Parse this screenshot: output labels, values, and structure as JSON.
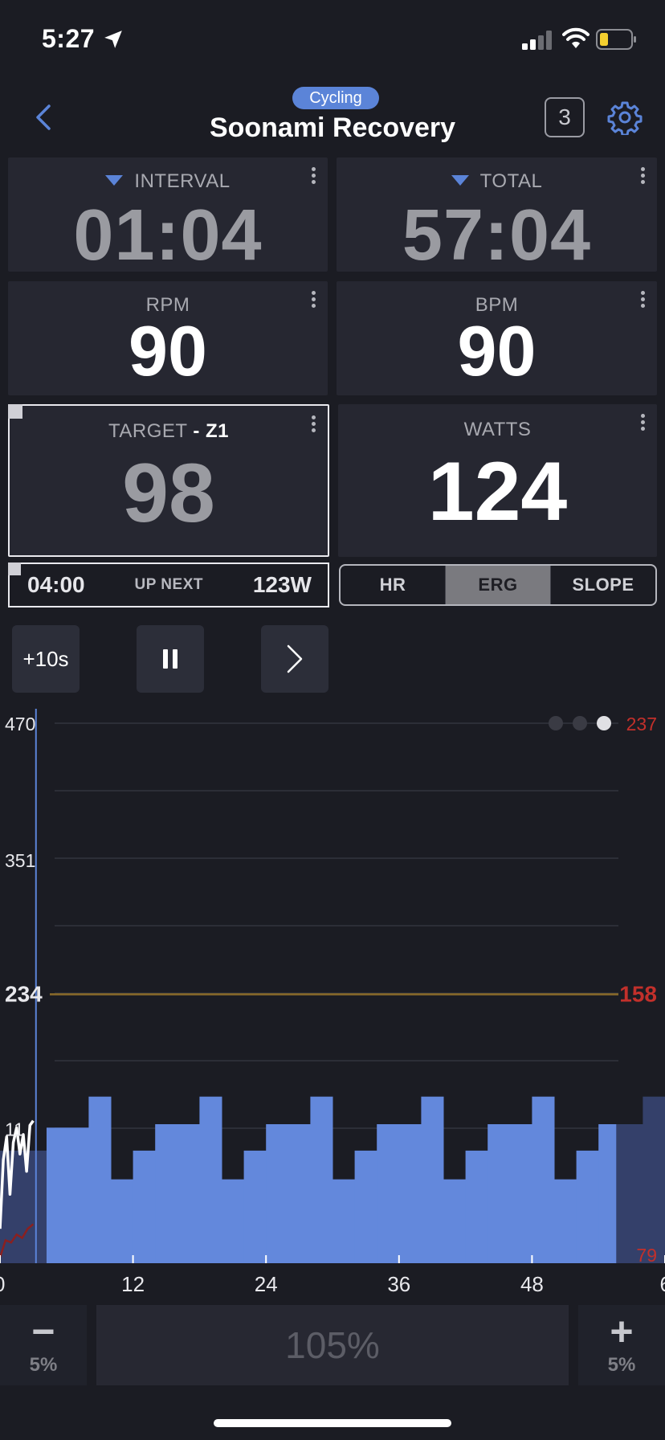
{
  "status_bar": {
    "time": "5:27"
  },
  "header": {
    "category": "Cycling",
    "title": "Soonami Recovery",
    "count": "3"
  },
  "tiles": {
    "interval": {
      "label": "INTERVAL",
      "value": "01:04"
    },
    "total": {
      "label": "TOTAL",
      "value": "57:04"
    },
    "rpm": {
      "label": "RPM",
      "value": "90"
    },
    "bpm": {
      "label": "BPM",
      "value": "90"
    },
    "target": {
      "label": "TARGET",
      "zone": "- Z1",
      "value": "98"
    },
    "watts": {
      "label": "WATTS",
      "value": "124"
    }
  },
  "up_next": {
    "time": "04:00",
    "label": "UP NEXT",
    "watts": "123W"
  },
  "modes": [
    {
      "label": "HR",
      "active": false
    },
    {
      "label": "ERG",
      "active": true
    },
    {
      "label": "SLOPE",
      "active": false
    }
  ],
  "controls": {
    "plus10": "+10s"
  },
  "chart_data": {
    "type": "area",
    "y_ticks_left": [
      "470",
      "351",
      "234",
      "11"
    ],
    "y_ticks_right": [
      "237",
      "158",
      "79"
    ],
    "x_ticks": [
      "0",
      "12",
      "24",
      "36",
      "48",
      "6"
    ],
    "xlim": [
      0,
      60
    ],
    "ylim": [
      0,
      470
    ],
    "ftp_line": 234,
    "current_time": 3.1,
    "segments": [
      {
        "start": 0,
        "end": 4.2,
        "watts": 98
      },
      {
        "start": 4.2,
        "end": 8,
        "watts": 118
      },
      {
        "start": 8,
        "end": 10,
        "watts": 145
      },
      {
        "start": 10,
        "end": 12,
        "watts": 73
      },
      {
        "start": 12,
        "end": 14,
        "watts": 98
      },
      {
        "start": 14,
        "end": 18,
        "watts": 121
      },
      {
        "start": 18,
        "end": 20,
        "watts": 145
      },
      {
        "start": 20,
        "end": 22,
        "watts": 73
      },
      {
        "start": 22,
        "end": 24,
        "watts": 98
      },
      {
        "start": 24,
        "end": 28,
        "watts": 121
      },
      {
        "start": 28,
        "end": 30,
        "watts": 145
      },
      {
        "start": 30,
        "end": 32,
        "watts": 73
      },
      {
        "start": 32,
        "end": 34,
        "watts": 98
      },
      {
        "start": 34,
        "end": 38,
        "watts": 121
      },
      {
        "start": 38,
        "end": 40,
        "watts": 145
      },
      {
        "start": 40,
        "end": 42,
        "watts": 73
      },
      {
        "start": 42,
        "end": 44,
        "watts": 98
      },
      {
        "start": 44,
        "end": 48,
        "watts": 121
      },
      {
        "start": 48,
        "end": 50,
        "watts": 145
      },
      {
        "start": 50,
        "end": 52,
        "watts": 73
      },
      {
        "start": 52,
        "end": 54,
        "watts": 98
      },
      {
        "start": 54,
        "end": 55.6,
        "watts": 121
      },
      {
        "start": 55.6,
        "end": 58,
        "watts": 121
      },
      {
        "start": 58,
        "end": 60,
        "watts": 145
      }
    ],
    "power_trace": [
      [
        0,
        30
      ],
      [
        0.3,
        90
      ],
      [
        0.6,
        110
      ],
      [
        0.9,
        60
      ],
      [
        1.2,
        105
      ],
      [
        1.5,
        118
      ],
      [
        1.8,
        95
      ],
      [
        2.1,
        112
      ],
      [
        2.4,
        80
      ],
      [
        2.7,
        120
      ],
      [
        3.0,
        124
      ]
    ],
    "hr_trace": [
      [
        0,
        5
      ],
      [
        0.5,
        20
      ],
      [
        1.0,
        18
      ],
      [
        1.5,
        25
      ],
      [
        2.0,
        22
      ],
      [
        2.5,
        30
      ],
      [
        3.0,
        34
      ]
    ],
    "colors": {
      "target": "#6388dc",
      "future": "#34406a",
      "ftp": "#8a6a2a",
      "power": "#ffffff",
      "hr": "#8a2020",
      "cursor": "#5b84d8",
      "red_label": "#c2302b"
    }
  },
  "intensity": {
    "minus_label": "5%",
    "plus_label": "5%",
    "value": "105%"
  }
}
